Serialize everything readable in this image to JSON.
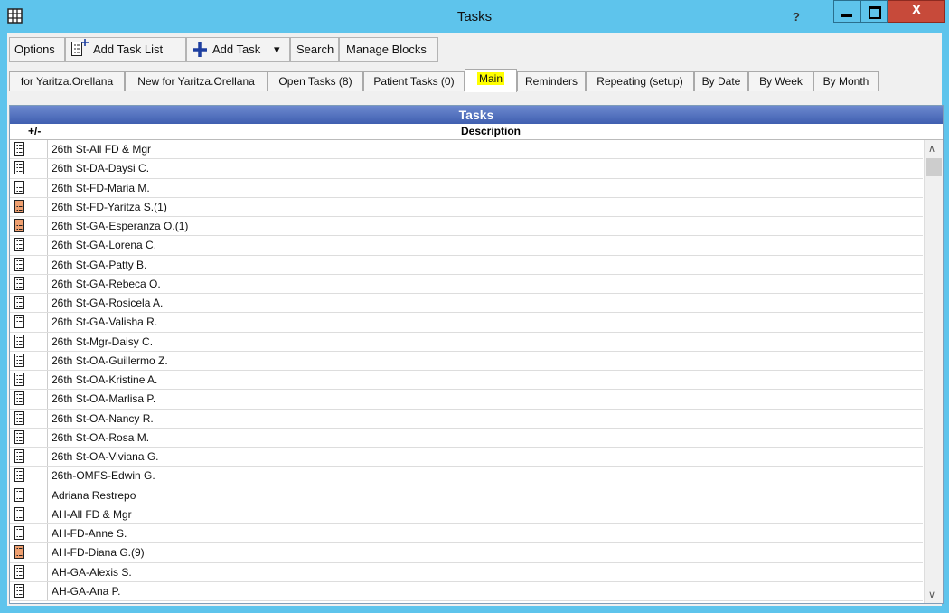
{
  "window": {
    "title": "Tasks",
    "help_label": "?",
    "close_label": "X"
  },
  "toolbar": {
    "options": "Options",
    "add_task_list": "Add Task List",
    "add_task": "Add Task",
    "dropdown": "▾",
    "search": "Search",
    "manage_blocks": "Manage Blocks"
  },
  "tabs": [
    {
      "label": "for Yaritza.Orellana"
    },
    {
      "label": "New for Yaritza.Orellana"
    },
    {
      "label": "Open Tasks (8)"
    },
    {
      "label": "Patient Tasks (0)"
    },
    {
      "label": "Main"
    },
    {
      "label": "Reminders"
    },
    {
      "label": "Repeating (setup)"
    },
    {
      "label": "By Date"
    },
    {
      "label": "By Week"
    },
    {
      "label": "By Month"
    }
  ],
  "grid": {
    "title": "Tasks",
    "col_plus": "+/-",
    "col_desc": "Description",
    "rows": [
      {
        "desc": "26th St-All FD & Mgr",
        "highlight": false
      },
      {
        "desc": "26th St-DA-Daysi C.",
        "highlight": false
      },
      {
        "desc": "26th St-FD-Maria M.",
        "highlight": false
      },
      {
        "desc": "26th St-FD-Yaritza S.(1)",
        "highlight": true
      },
      {
        "desc": "26th St-GA-Esperanza O.(1)",
        "highlight": true
      },
      {
        "desc": "26th St-GA-Lorena C.",
        "highlight": false
      },
      {
        "desc": "26th St-GA-Patty B.",
        "highlight": false
      },
      {
        "desc": "26th St-GA-Rebeca O.",
        "highlight": false
      },
      {
        "desc": "26th St-GA-Rosicela A.",
        "highlight": false
      },
      {
        "desc": "26th St-GA-Valisha R.",
        "highlight": false
      },
      {
        "desc": "26th St-Mgr-Daisy C.",
        "highlight": false
      },
      {
        "desc": "26th St-OA-Guillermo Z.",
        "highlight": false
      },
      {
        "desc": "26th St-OA-Kristine A.",
        "highlight": false
      },
      {
        "desc": "26th St-OA-Marlisa P.",
        "highlight": false
      },
      {
        "desc": "26th St-OA-Nancy R.",
        "highlight": false
      },
      {
        "desc": "26th St-OA-Rosa M.",
        "highlight": false
      },
      {
        "desc": "26th St-OA-Viviana G.",
        "highlight": false
      },
      {
        "desc": "26th-OMFS-Edwin G.",
        "highlight": false
      },
      {
        "desc": "Adriana Restrepo",
        "highlight": false
      },
      {
        "desc": "AH-All FD & Mgr",
        "highlight": false
      },
      {
        "desc": "AH-FD-Anne S.",
        "highlight": false
      },
      {
        "desc": "AH-FD-Diana G.(9)",
        "highlight": true
      },
      {
        "desc": "AH-GA-Alexis S.",
        "highlight": false
      },
      {
        "desc": "AH-GA-Ana P.",
        "highlight": false
      }
    ]
  },
  "colors": {
    "titlebar": "#5ec4ec",
    "close": "#c74a3a",
    "grid_title": "#4a68b8",
    "active_tab_highlight": "#ffff00",
    "task_icon_highlight": "#f0a070"
  }
}
